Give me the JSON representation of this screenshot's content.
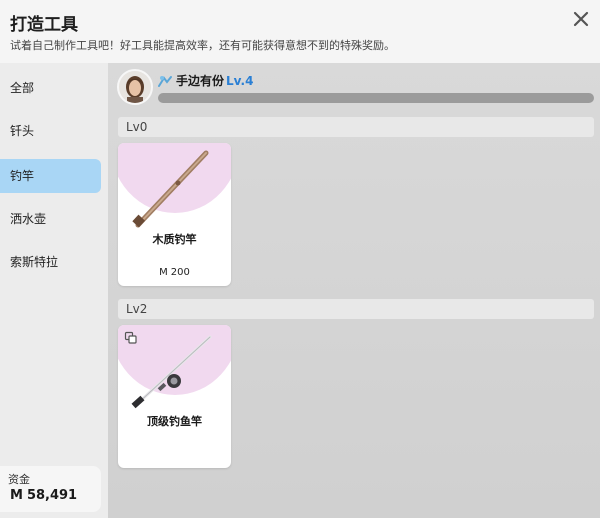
{
  "header": {
    "title": "打造工具",
    "subtitle": "试着自己制作工具吧！好工具能提高效率，还有可能获得意想不到的特殊奖励。"
  },
  "sidebar": {
    "items": [
      {
        "label": "全部"
      },
      {
        "label": "钎头"
      },
      {
        "label": "钓竿",
        "active": true
      },
      {
        "label": "洒水壶"
      },
      {
        "label": "索斯特拉"
      }
    ]
  },
  "funds": {
    "label": "资金",
    "currency_symbol": "M",
    "amount": "58,491"
  },
  "skill": {
    "name": "手边有份",
    "level": "Lv.4",
    "progress": 0.0
  },
  "sections": [
    {
      "label": "Lv0",
      "cards": [
        {
          "name": "木质钓竿",
          "currency_symbol": "M",
          "price": "200",
          "icon": "wooden-fishing-rod-icon"
        }
      ]
    },
    {
      "label": "Lv2",
      "cards": [
        {
          "name": "顶级钓鱼竿",
          "icon": "premium-fishing-rod-icon"
        }
      ]
    }
  ],
  "colors": {
    "active_tab": "#a9d6f5",
    "level_text": "#2a7fd4",
    "card_accent": "#f1d9ef"
  }
}
